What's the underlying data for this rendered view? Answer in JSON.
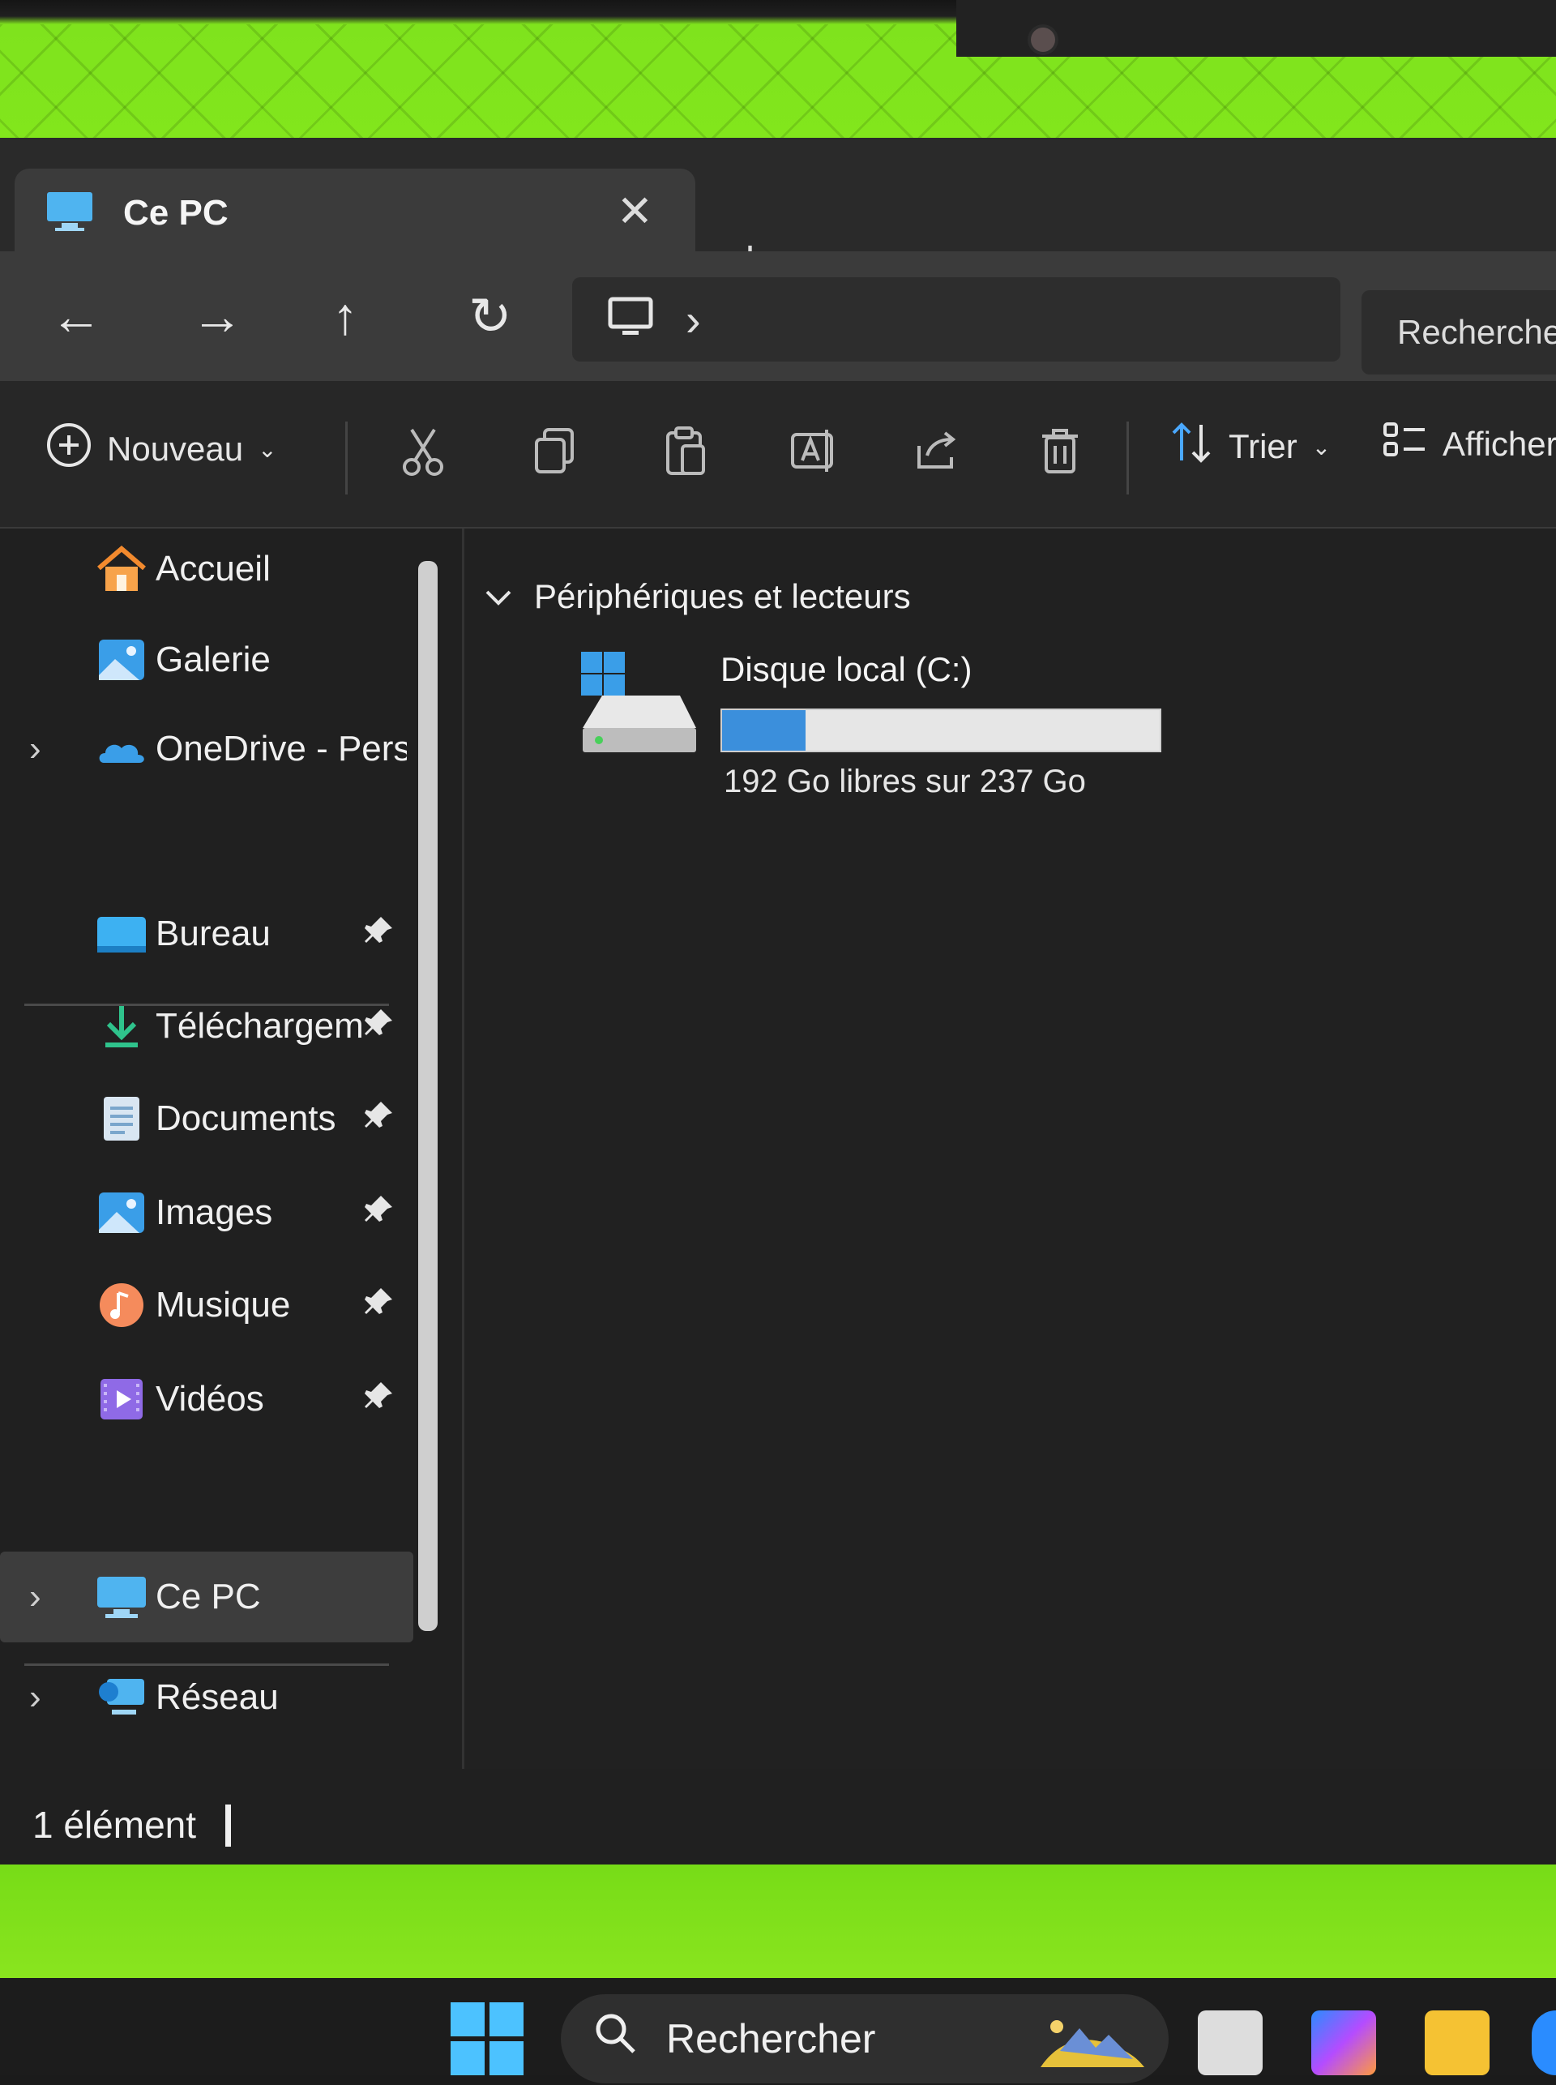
{
  "window": {
    "tab_title": "Ce PC",
    "close_glyph": "✕",
    "newtab_glyph": "+"
  },
  "nav": {
    "back": "←",
    "forward": "→",
    "up": "↑",
    "refresh": "↻",
    "breadcrumb_chevron": "›",
    "search_placeholder": "Rechercher"
  },
  "toolbar": {
    "new_label": "Nouveau",
    "sort_label": "Trier",
    "view_label": "Afficher"
  },
  "sidebar": {
    "items": [
      {
        "label": "Accueil",
        "icon": "home-icon"
      },
      {
        "label": "Galerie",
        "icon": "gallery-icon"
      },
      {
        "label": "OneDrive - Persc",
        "icon": "onedrive-icon"
      },
      {
        "label": "Bureau",
        "icon": "desktop-folder-icon"
      },
      {
        "label": "Téléchargeme",
        "icon": "downloads-icon"
      },
      {
        "label": "Documents",
        "icon": "documents-icon"
      },
      {
        "label": "Images",
        "icon": "pictures-icon"
      },
      {
        "label": "Musique",
        "icon": "music-icon"
      },
      {
        "label": "Vidéos",
        "icon": "videos-icon"
      },
      {
        "label": "Ce PC",
        "icon": "this-pc-icon"
      },
      {
        "label": "Réseau",
        "icon": "network-icon"
      }
    ]
  },
  "content": {
    "group_title": "Périphériques et lecteurs",
    "drive": {
      "name": "Disque local (C:)",
      "free_text": "192 Go libres sur 237 Go",
      "used_fraction": 0.19
    }
  },
  "status": {
    "count_text": "1 élément"
  },
  "taskbar": {
    "search_placeholder": "Rechercher"
  },
  "colors": {
    "accent": "#3b8fdc",
    "wallpaper_green": "#84e81c"
  }
}
